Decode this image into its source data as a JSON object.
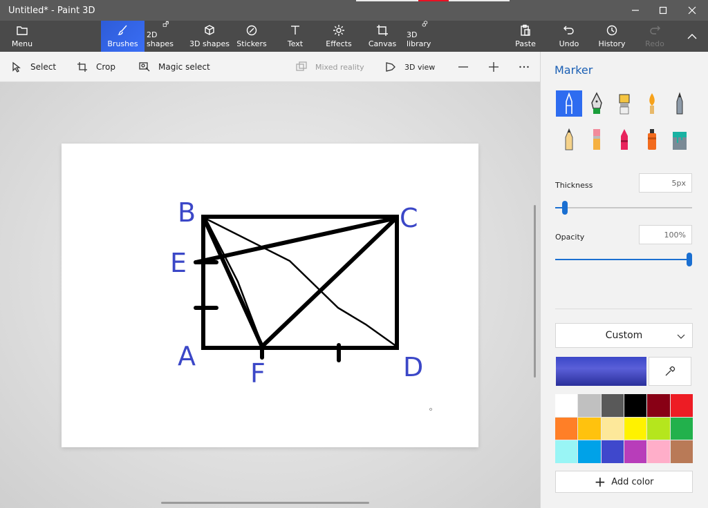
{
  "window": {
    "title": "Untitled* - Paint 3D"
  },
  "ribbon": {
    "menu": "Menu",
    "tabs": [
      {
        "label": "Brushes",
        "icon": "brush-icon"
      },
      {
        "label": "2D shapes",
        "icon": "2d-shapes-icon"
      },
      {
        "label": "3D shapes",
        "icon": "3d-shapes-icon"
      },
      {
        "label": "Stickers",
        "icon": "stickers-icon"
      },
      {
        "label": "Text",
        "icon": "text-icon"
      },
      {
        "label": "Effects",
        "icon": "effects-icon"
      },
      {
        "label": "Canvas",
        "icon": "canvas-icon"
      },
      {
        "label": "3D library",
        "icon": "3d-library-icon"
      }
    ],
    "paste": "Paste",
    "undo": "Undo",
    "history": "History",
    "redo": "Redo",
    "active_color": "#2e5cd8"
  },
  "toolbar": {
    "select": "Select",
    "crop": "Crop",
    "magic_select": "Magic select",
    "mixed_reality": "Mixed reality",
    "view_3d": "3D view"
  },
  "canvas_labels": {
    "b": "B",
    "c": "C",
    "e": "E",
    "a": "A",
    "f": "F",
    "d": "D",
    "ink_color": "#3b47c7"
  },
  "panel": {
    "title": "Marker",
    "thickness_label": "Thickness",
    "thickness_value": "5px",
    "thickness_level": 0.05,
    "opacity_label": "Opacity",
    "opacity_value": "100%",
    "opacity_level": 1.0,
    "color_mode": "Custom",
    "current_color": "#3b47c7",
    "palette": [
      "#ffffff",
      "#c0c0c0",
      "#595959",
      "#000000",
      "#880015",
      "#ed1c24",
      "#ff7f27",
      "#ffc20e",
      "#fde89a",
      "#fff200",
      "#b5e61d",
      "#22b14c",
      "#99f5f5",
      "#00a2e8",
      "#3f48cc",
      "#b83dba",
      "#ffaec9",
      "#b97a57"
    ],
    "add_color": "Add color",
    "accent": "#1a6fd1"
  }
}
